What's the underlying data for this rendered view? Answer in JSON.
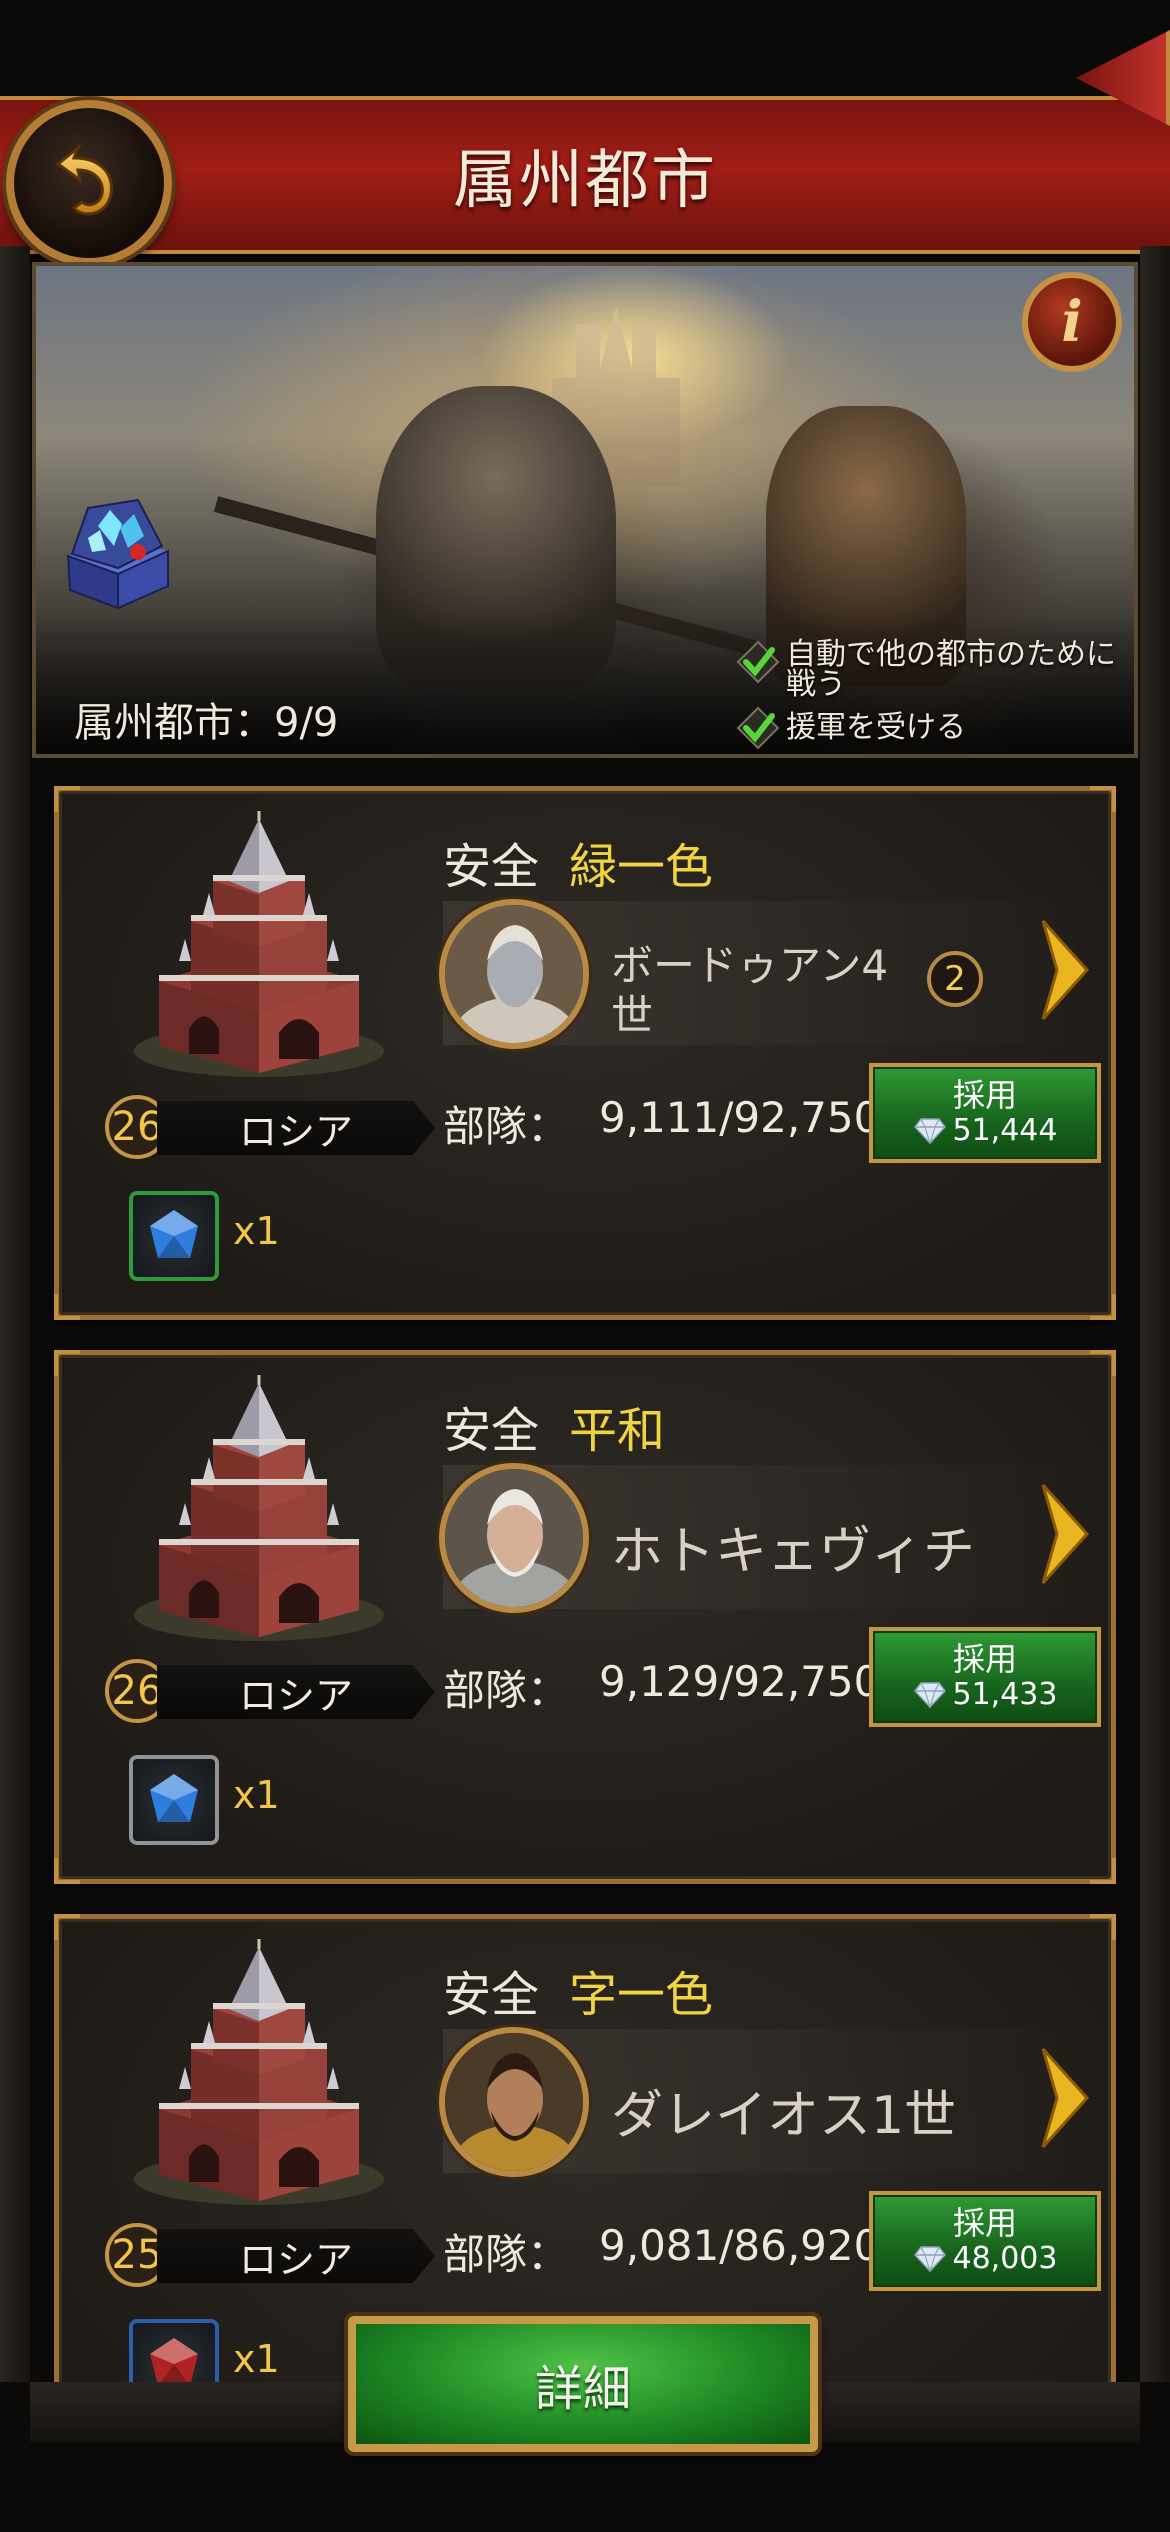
{
  "header": {
    "title": "属州都市",
    "back_icon": "back-arrow-icon"
  },
  "banner": {
    "count_text": "属州都市：9/9",
    "info_label": "i",
    "options": [
      {
        "checked": true,
        "label_line1": "自動で他の都市のために",
        "label_line2": "戦う"
      },
      {
        "checked": true,
        "label_line1": "援軍を受ける",
        "label_line2": ""
      }
    ]
  },
  "cities": [
    {
      "level": "26",
      "nation": "ロシア",
      "status_safe": "安全",
      "status_name": "緑一色",
      "hero_name_line1": "ボードゥアン4",
      "hero_name_line2": "世",
      "hero_badge": "2",
      "troops_label": "部隊：",
      "troops_value": "9,111/92,750",
      "hire_label": "採用",
      "hire_cost": "51,444",
      "gem_qty": "x1",
      "gem_frame_color": "#2e9b3a"
    },
    {
      "level": "26",
      "nation": "ロシア",
      "status_safe": "安全",
      "status_name": "平和",
      "hero_name_line1": "ホトキェヴィチ",
      "hero_name_line2": "",
      "hero_badge": "",
      "troops_label": "部隊：",
      "troops_value": "9,129/92,750",
      "hire_label": "採用",
      "hire_cost": "51,433",
      "gem_qty": "x1",
      "gem_frame_color": "#8f9499"
    },
    {
      "level": "25",
      "nation": "ロシア",
      "status_safe": "安全",
      "status_name": "字一色",
      "hero_name_line1": "ダレイオス1世",
      "hero_name_line2": "",
      "hero_badge": "",
      "troops_label": "部隊：",
      "troops_value": "9,081/86,920",
      "hire_label": "採用",
      "hire_cost": "48,003",
      "gem_qty": "x1",
      "gem_frame_color": "#2b5fae"
    }
  ],
  "footer": {
    "detail_label": "詳細"
  },
  "colors": {
    "header_red": "#a11e16",
    "gold": "#c2883c",
    "status_yellow": "#f2d440",
    "button_green": "#1e8a24"
  }
}
